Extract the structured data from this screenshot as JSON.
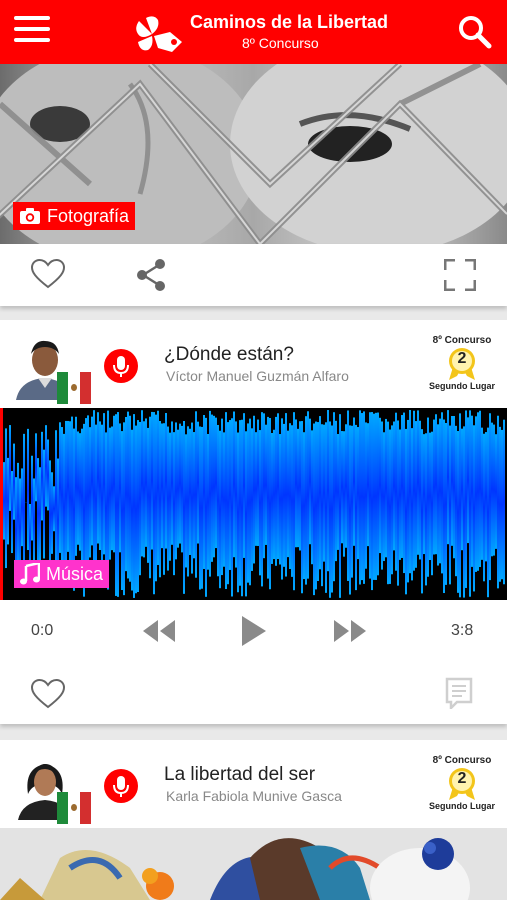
{
  "header": {
    "title": "Caminos de la Libertad",
    "subtitle": "8º Concurso",
    "brand_color": "#ff0000"
  },
  "posts": [
    {
      "category": "Fotografía",
      "category_icon": "camera-icon",
      "category_color": "#ff0000"
    },
    {
      "title": "¿Dónde están?",
      "author": "Víctor Manuel Guzmán Alfaro",
      "award_contest": "8º Concurso",
      "award_place_number": "2",
      "award_place": "Segundo Lugar",
      "category": "Música",
      "category_icon": "music-note-icon",
      "category_color": "#ff33cc",
      "player": {
        "current_time": "0:0",
        "total_time": "3:8"
      }
    },
    {
      "title": "La libertad del ser",
      "author": "Karla Fabiola Munive Gasca",
      "award_contest": "8º Concurso",
      "award_place_number": "2",
      "award_place": "Segundo Lugar"
    }
  ]
}
